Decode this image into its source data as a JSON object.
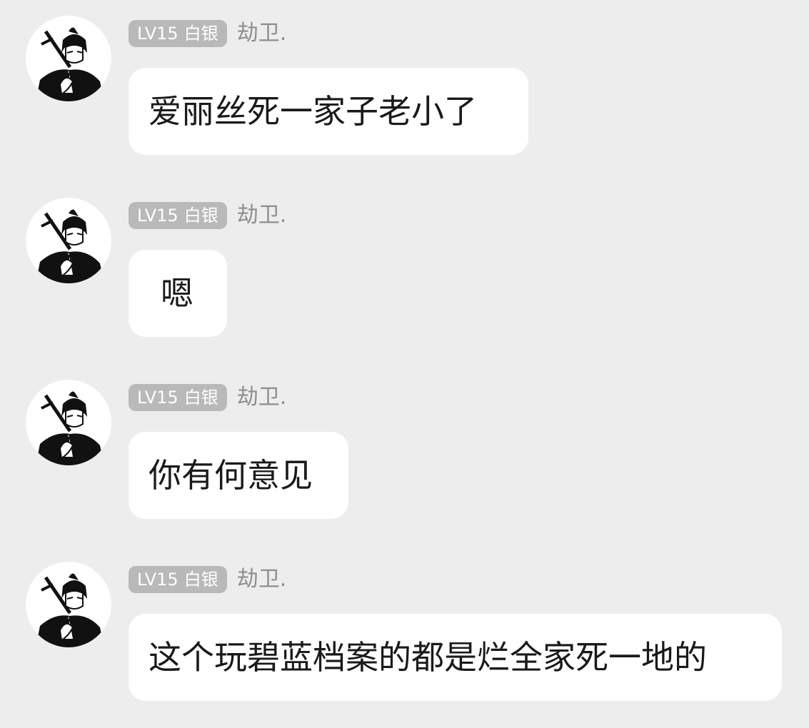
{
  "messages": [
    {
      "badge_level": "LV15",
      "badge_rank": "白银",
      "sender": "劫卫.",
      "avatar_icon": "anime-character-avatar-icon",
      "text": "爱丽丝死一家子老小了"
    },
    {
      "badge_level": "LV15",
      "badge_rank": "白银",
      "sender": "劫卫.",
      "avatar_icon": "anime-character-avatar-icon",
      "text": "嗯"
    },
    {
      "badge_level": "LV15",
      "badge_rank": "白银",
      "sender": "劫卫.",
      "avatar_icon": "anime-character-avatar-icon",
      "text": "你有何意见"
    },
    {
      "badge_level": "LV15",
      "badge_rank": "白银",
      "sender": "劫卫.",
      "avatar_icon": "anime-character-avatar-icon",
      "text": "这个玩碧蓝档案的都是烂全家死一地的"
    }
  ],
  "colors": {
    "background": "#ededed",
    "bubble": "#ffffff",
    "badge": "#b9b9b9",
    "sender_name": "#8e8e8e",
    "message_text": "#1a1a1a"
  }
}
